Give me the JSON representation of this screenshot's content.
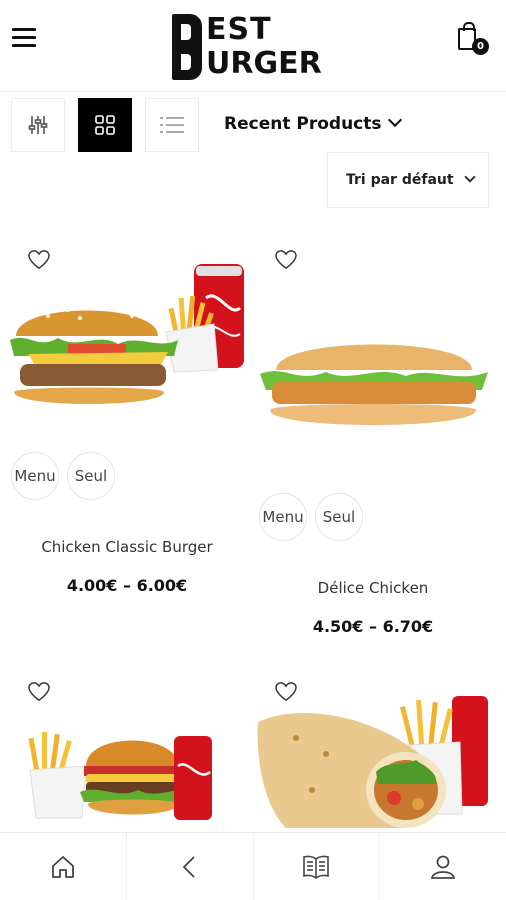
{
  "header": {
    "logo_line1": "EST",
    "logo_line2": "URGER",
    "logo_text": "BEST BURGER",
    "cart_count": "0"
  },
  "toolbar": {
    "recent_label": "Recent Products",
    "sort_label": "Tri par défaut"
  },
  "products": [
    {
      "name": "Chicken Classic Burger",
      "price": "4.00€ – 6.00€",
      "option1": "Menu",
      "option2": "Seul"
    },
    {
      "name": "Délice Chicken",
      "price": "4.50€ – 6.70€",
      "option1": "Menu",
      "option2": "Seul"
    }
  ],
  "icons": {
    "menu": "hamburger-menu-icon",
    "cart": "shopping-bag-icon",
    "filter": "filter-sliders-icon",
    "grid": "grid-view-icon",
    "list": "list-view-icon",
    "wishlist": "heart-icon",
    "home": "home-icon",
    "back": "chevron-left-icon",
    "book": "book-icon",
    "account": "user-icon"
  },
  "colors": {
    "accent": "#000000",
    "border": "#ececec",
    "bun": "#d9952f",
    "cola": "#d4121c"
  }
}
